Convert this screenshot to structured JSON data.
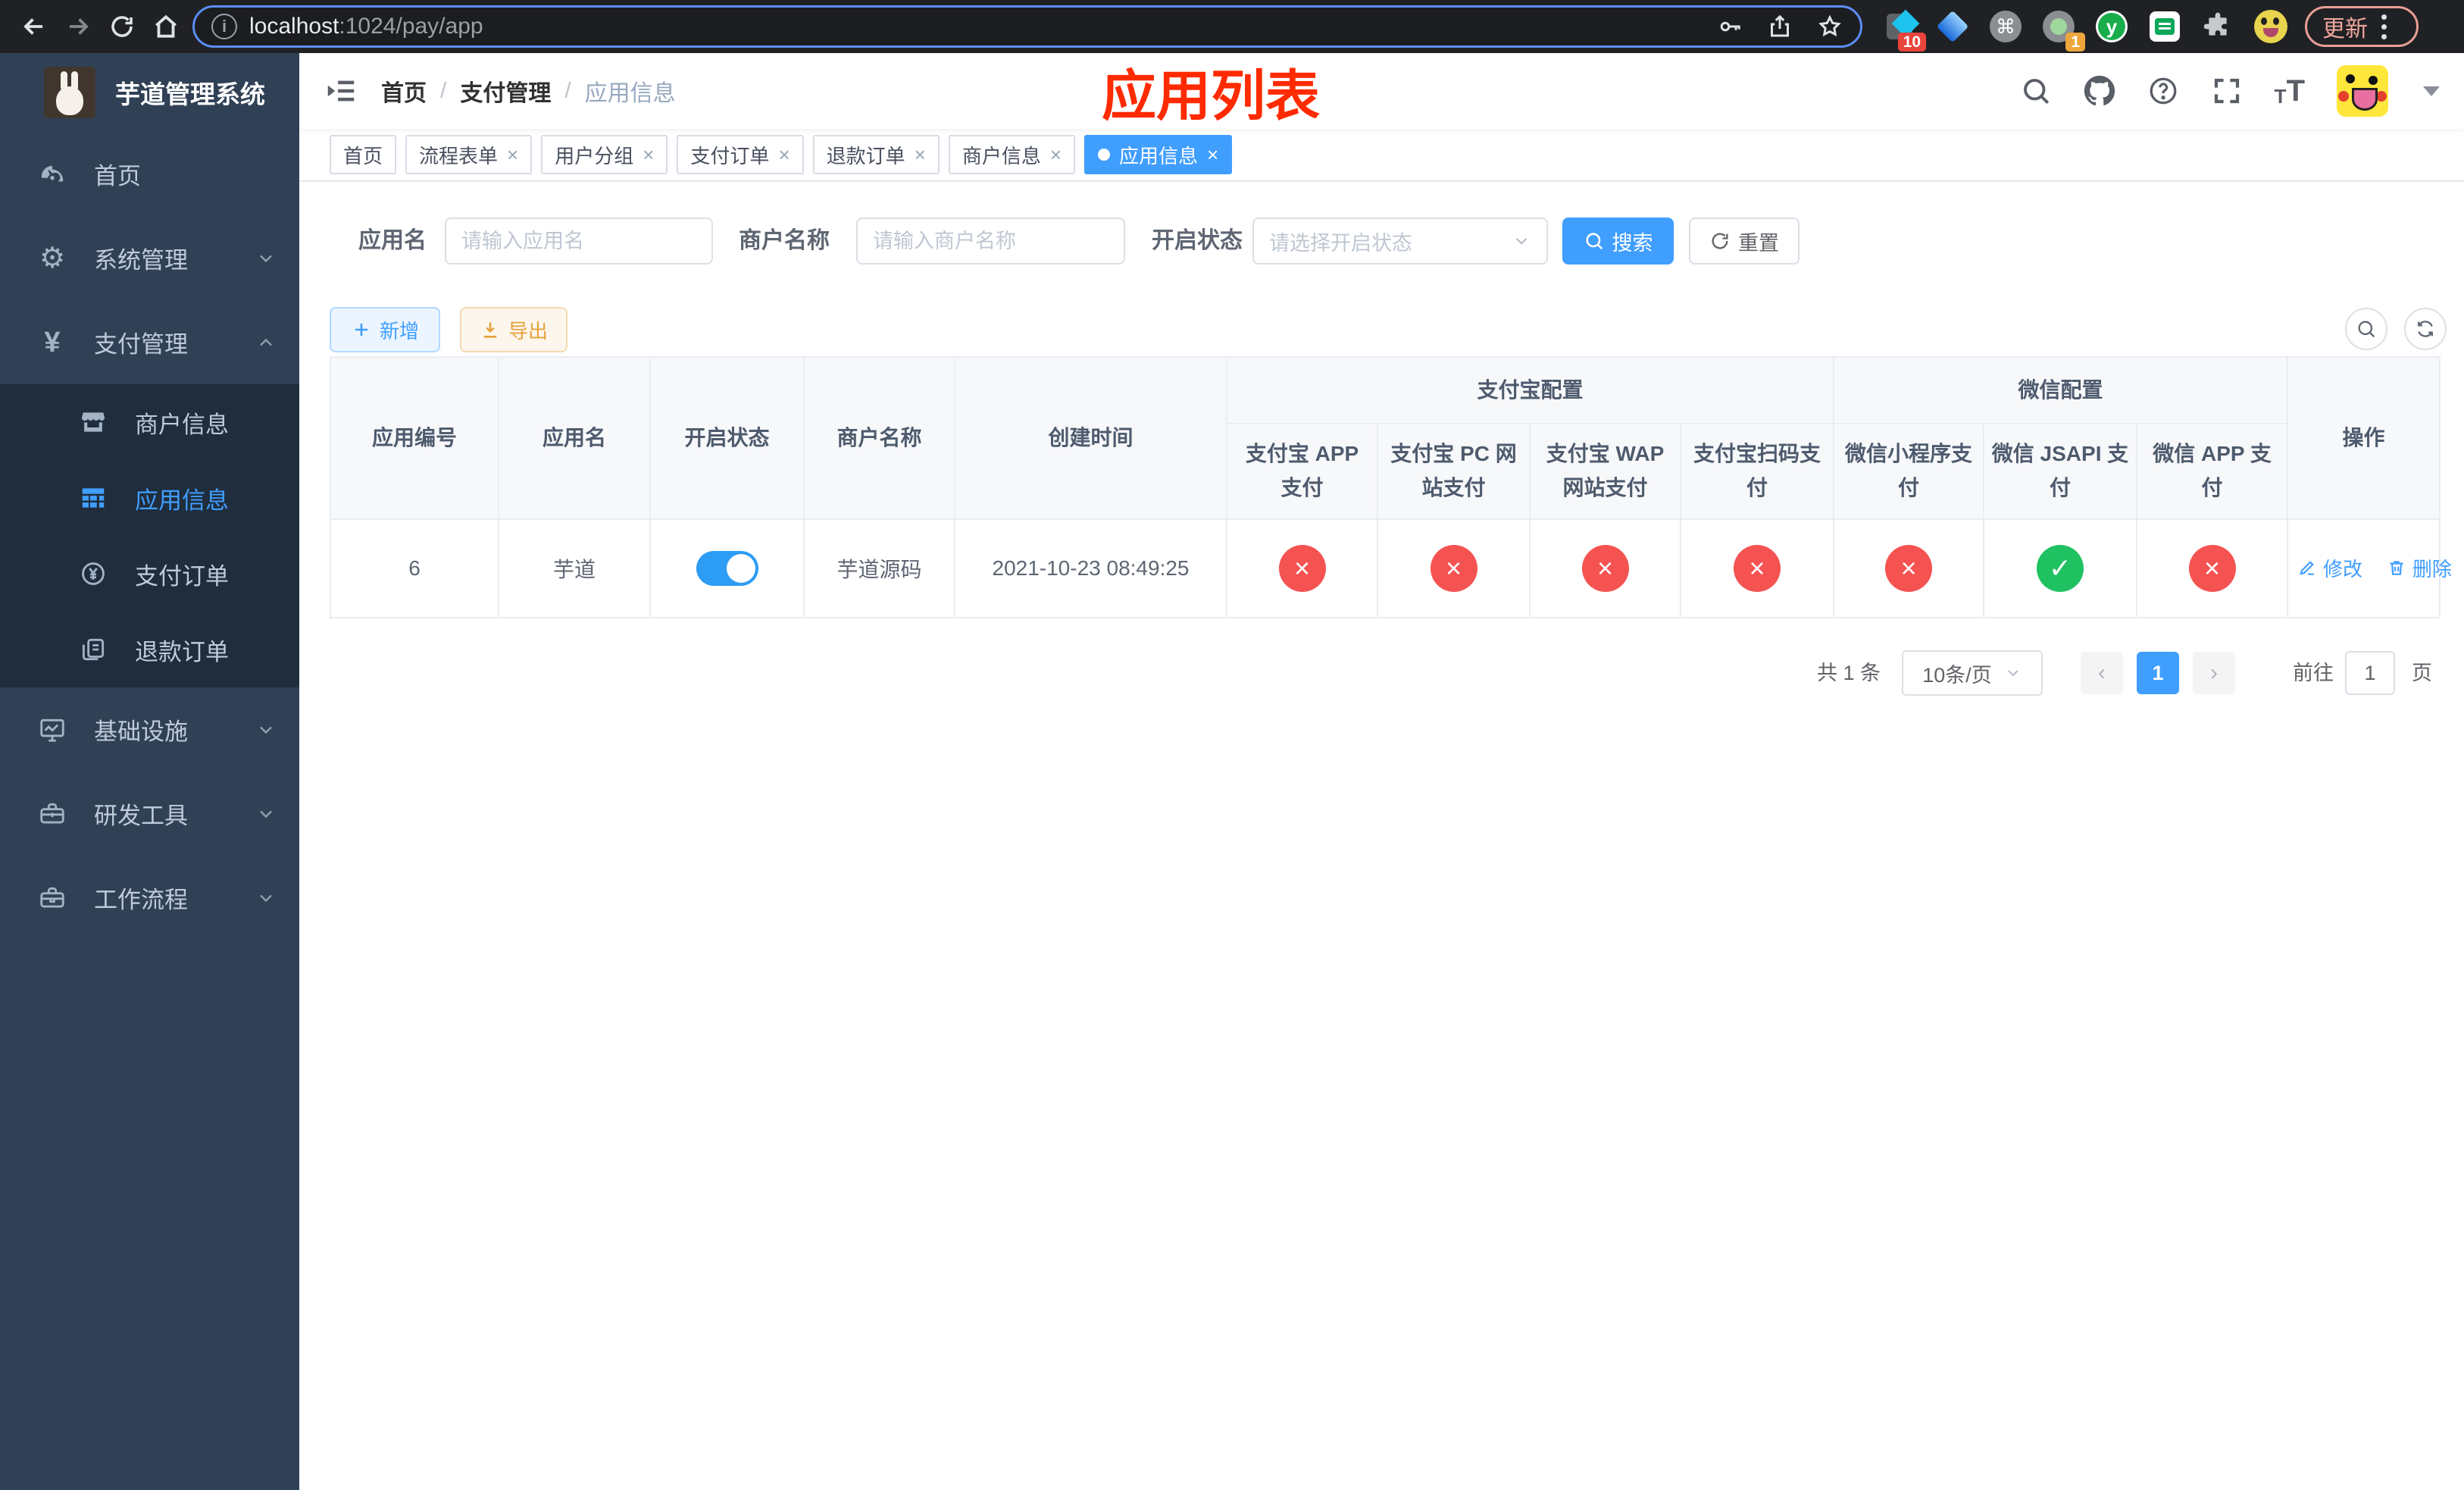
{
  "browser": {
    "url": {
      "host": "localhost",
      "path": ":1024/pay/app"
    },
    "extensions": {
      "badge1": "10",
      "badge2": "1"
    },
    "update_label": "更新"
  },
  "sidebar": {
    "title": "芋道管理系统",
    "menu": [
      {
        "label": "首页",
        "icon": "dashboard-icon"
      },
      {
        "label": "系统管理",
        "icon": "gear-icon",
        "chevron": "down"
      },
      {
        "label": "支付管理",
        "icon": "yen-icon",
        "chevron": "up",
        "children": [
          {
            "label": "商户信息",
            "icon": "store-icon"
          },
          {
            "label": "应用信息",
            "icon": "grid-icon",
            "active": true
          },
          {
            "label": "支付订单",
            "icon": "coin-icon"
          },
          {
            "label": "退款订单",
            "icon": "docs-icon"
          }
        ]
      },
      {
        "label": "基础设施",
        "icon": "monitor-icon",
        "chevron": "down"
      },
      {
        "label": "研发工具",
        "icon": "toolbox-icon",
        "chevron": "down"
      },
      {
        "label": "工作流程",
        "icon": "workflow-icon",
        "chevron": "down"
      }
    ]
  },
  "header": {
    "breadcrumb": [
      "首页",
      "支付管理",
      "应用信息"
    ],
    "annotation": "应用列表"
  },
  "tabs": [
    {
      "label": "首页",
      "closable": false,
      "active": false
    },
    {
      "label": "流程表单",
      "closable": true,
      "active": false
    },
    {
      "label": "用户分组",
      "closable": true,
      "active": false
    },
    {
      "label": "支付订单",
      "closable": true,
      "active": false
    },
    {
      "label": "退款订单",
      "closable": true,
      "active": false
    },
    {
      "label": "商户信息",
      "closable": true,
      "active": false
    },
    {
      "label": "应用信息",
      "closable": true,
      "active": true
    }
  ],
  "filters": {
    "app_name": {
      "label": "应用名",
      "placeholder": "请输入应用名"
    },
    "merchant_name": {
      "label": "商户名称",
      "placeholder": "请输入商户名称"
    },
    "status": {
      "label": "开启状态",
      "placeholder": "请选择开启状态"
    },
    "search_label": "搜索",
    "reset_label": "重置"
  },
  "toolbar": {
    "add_label": "新增",
    "export_label": "导出"
  },
  "table": {
    "columns": [
      "应用编号",
      "应用名",
      "开启状态",
      "商户名称",
      "创建时间"
    ],
    "groups": [
      {
        "title": "支付宝配置",
        "columns": [
          "支付宝 APP 支付",
          "支付宝 PC 网站支付",
          "支付宝 WAP 网站支付",
          "支付宝扫码支付"
        ]
      },
      {
        "title": "微信配置",
        "columns": [
          "微信小程序支付",
          "微信 JSAPI 支付",
          "微信 APP 支付"
        ]
      }
    ],
    "ops_column": "操作",
    "rows": [
      {
        "id": "6",
        "name": "芋道",
        "enabled": true,
        "merchant": "芋道源码",
        "created": "2021-10-23 08:49:25",
        "pay_statuses": [
          false,
          false,
          false,
          false,
          false,
          true,
          false
        ],
        "edit_label": "修改",
        "delete_label": "删除"
      }
    ]
  },
  "pagination": {
    "total": "共 1 条",
    "page_size": "10条/页",
    "current_page": "1",
    "goto_label": "前往",
    "goto_value": "1",
    "unit_label": "页"
  },
  "colors": {
    "accent": "#409eff",
    "danger": "#f45352",
    "success": "#1fc161",
    "warning": "#e6a23c",
    "annotation": "#ff2b00",
    "sidebar_bg": "#304156",
    "submenu_bg": "#1f2d3d"
  }
}
